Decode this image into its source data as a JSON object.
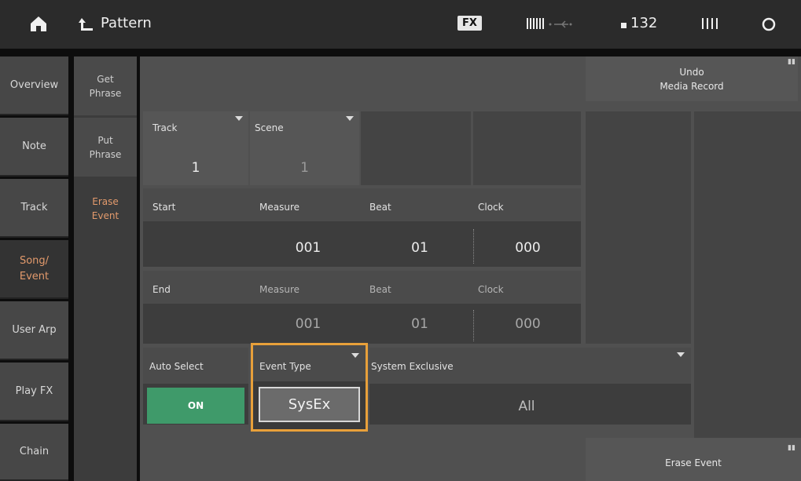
{
  "topbar": {
    "title": "Pattern",
    "fx": "FX",
    "tempo": "132"
  },
  "left_nav": [
    {
      "label": "Overview"
    },
    {
      "label": "Note"
    },
    {
      "label": "Track"
    },
    {
      "label": "Song/\nEvent"
    },
    {
      "label": "User Arp"
    },
    {
      "label": "Play FX"
    },
    {
      "label": "Chain"
    }
  ],
  "sub_nav": [
    {
      "label": "Get\nPhrase"
    },
    {
      "label": "Put\nPhrase"
    },
    {
      "label": "Erase\nEvent"
    }
  ],
  "undo": "Undo\nMedia Record",
  "track": {
    "label": "Track",
    "value": "1"
  },
  "scene": {
    "label": "Scene",
    "value": "1"
  },
  "start": {
    "label": "Start",
    "measure_label": "Measure",
    "beat_label": "Beat",
    "clock_label": "Clock",
    "measure": "001",
    "beat": "01",
    "clock": "000"
  },
  "end": {
    "label": "End",
    "measure_label": "Measure",
    "beat_label": "Beat",
    "clock_label": "Clock",
    "measure": "001",
    "beat": "01",
    "clock": "000"
  },
  "auto_select": {
    "label": "Auto Select",
    "value": "ON"
  },
  "event_type": {
    "label": "Event Type",
    "value": "SysEx"
  },
  "system_exclusive": {
    "label": "System Exclusive",
    "value": "All"
  },
  "erase_event_button": "Erase Event",
  "colors": {
    "accent_orange": "#e8a03a",
    "active_text": "#e39a6c",
    "on_green": "#3f9a6a"
  }
}
